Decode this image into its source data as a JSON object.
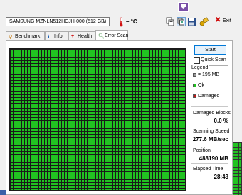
{
  "toolbar": {
    "drive": "SAMSUNG MZNLN512HCJH-000 (512 GB)",
    "temperature": "– °C",
    "exit_label": "Exit"
  },
  "tabs": [
    {
      "label": "Benchmark",
      "icon": "benchmark-icon"
    },
    {
      "label": "Info",
      "icon": "info-icon"
    },
    {
      "label": "Health",
      "icon": "health-icon"
    },
    {
      "label": "Error Scan",
      "icon": "error-scan-icon"
    }
  ],
  "active_tab": "Error Scan",
  "scan": {
    "start_label": "Start",
    "quick_scan_label": "Quick Scan",
    "quick_scan_checked": false,
    "legend_title": "Legend",
    "legend": [
      {
        "label": "= 195 MB",
        "color": "#9a9a9a"
      },
      {
        "label": "Ok",
        "color": "#21c321"
      },
      {
        "label": "Damaged",
        "color": "#c01818"
      }
    ],
    "grid_color": "#21c321"
  },
  "stats": {
    "damaged_label": "Damaged Blocks",
    "damaged_value": "0.0 %",
    "speed_label": "Scanning Speed",
    "speed_value": "277.6 MB/sec",
    "position_label": "Position",
    "position_value": "488190 MB",
    "elapsed_label": "Elapsed Time",
    "elapsed_value": "28:43"
  }
}
